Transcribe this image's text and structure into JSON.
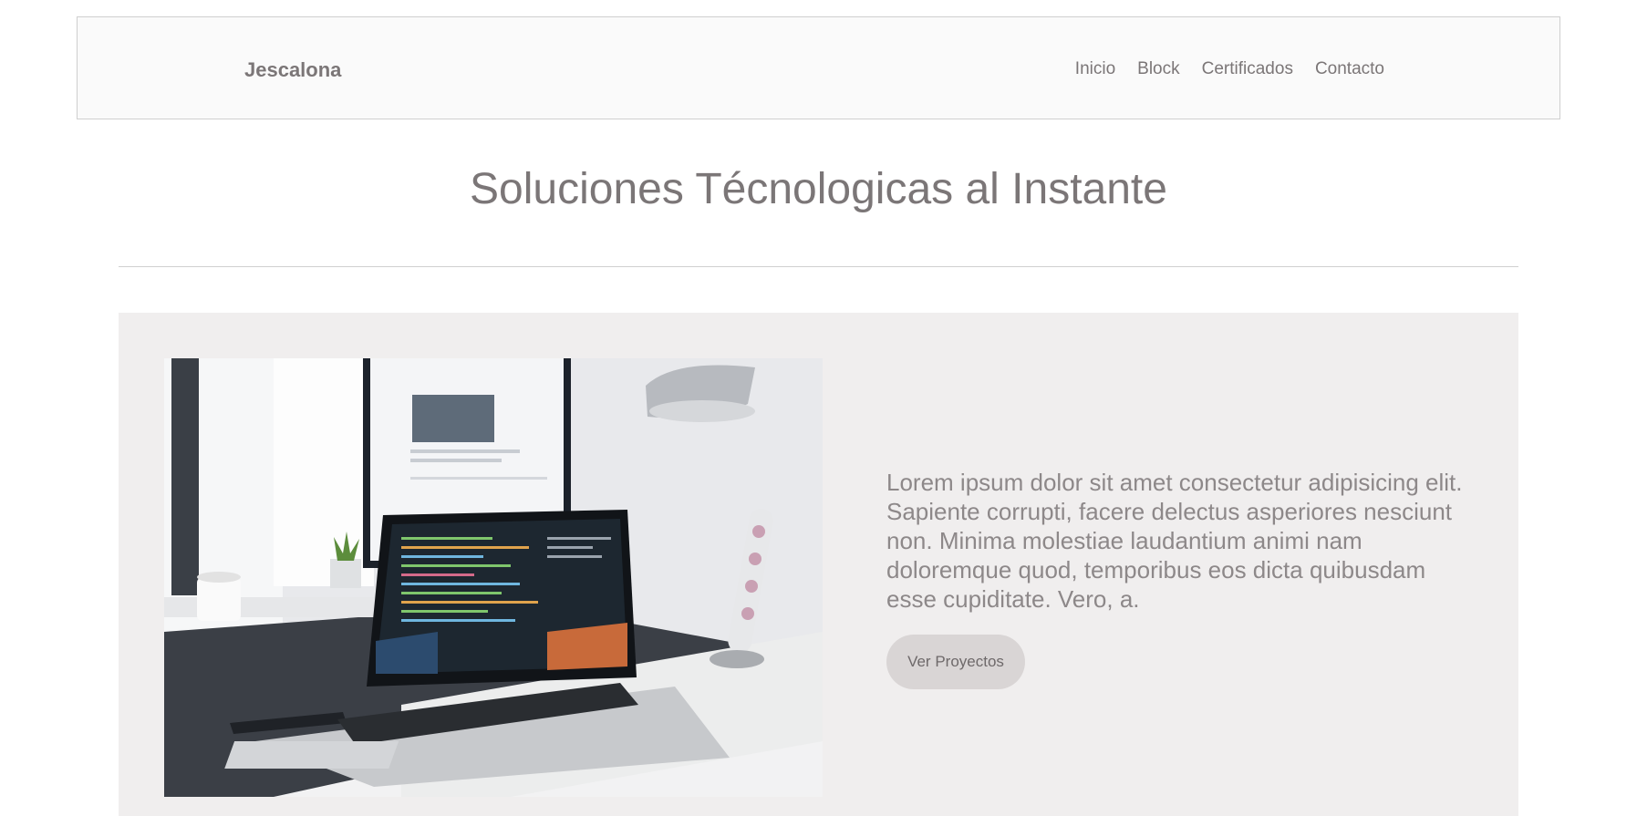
{
  "header": {
    "brand": "Jescalona",
    "nav": [
      {
        "label": "Inicio"
      },
      {
        "label": "Block"
      },
      {
        "label": "Certificados"
      },
      {
        "label": "Contacto"
      }
    ]
  },
  "hero": {
    "title": "Soluciones Técnologicas al Instante"
  },
  "feature": {
    "image_icon": "laptop-desk-photo",
    "text": "Lorem ipsum dolor sit amet consectetur adipisicing elit. Sapiente corrupti, facere delectus asperiores nesciunt non. Minima molestiae laudantium animi nam doloremque quod, temporibus eos dicta quibusdam esse cupiditate. Vero, a.",
    "button_label": "Ver Proyectos"
  }
}
